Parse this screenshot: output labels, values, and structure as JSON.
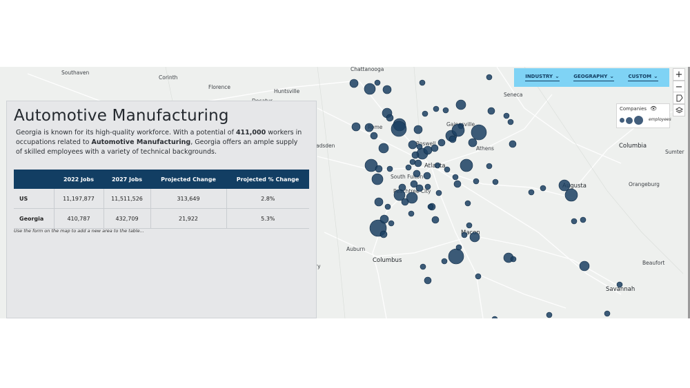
{
  "panel": {
    "title": "Automotive Manufacturing",
    "intro_part1": "Georgia is known for its high-quality workforce. With a potential of ",
    "intro_bold1": "411,000",
    "intro_part2": " workers in occupations related to ",
    "intro_bold2": "Automotive Manufacturing",
    "intro_part3": ", Georgia offers an ample supply of skilled employees with a variety of technical backgrounds.",
    "table": {
      "headers": [
        "",
        "2022 Jobs",
        "2027 Jobs",
        "Projected Change",
        "Projected % Change"
      ],
      "rows": [
        [
          "US",
          "11,197,877",
          "11,511,526",
          "313,649",
          "2.8%"
        ],
        [
          "Georgia",
          "410,787",
          "432,709",
          "21,922",
          "5.3%"
        ]
      ]
    },
    "note": "Use the form on the map to add a new area to the table..."
  },
  "filters": {
    "industry": "INDUSTRY",
    "geography": "GEOGRAPHY",
    "custom": "CUSTOM"
  },
  "controls": {
    "zoom_in": "+",
    "zoom_out": "−"
  },
  "legend": {
    "title": "Companies",
    "size_label": "employees"
  },
  "map": {
    "cities": [
      "Chattanooga",
      "Southaven",
      "Corinth",
      "Florence",
      "Huntsville",
      "Decatur",
      "Seneca",
      "Gainesville",
      "Rome",
      "Roswell",
      "Athens",
      "Columbia",
      "Sumter",
      "Atlanta",
      "South Fulton",
      "Peachtree City",
      "Augusta",
      "Orangeburg",
      "Macon",
      "Auburn",
      "Columbus",
      "Beaufort",
      "Savannah",
      "adsden",
      "ry"
    ],
    "marker_color": "#1b3f62"
  }
}
